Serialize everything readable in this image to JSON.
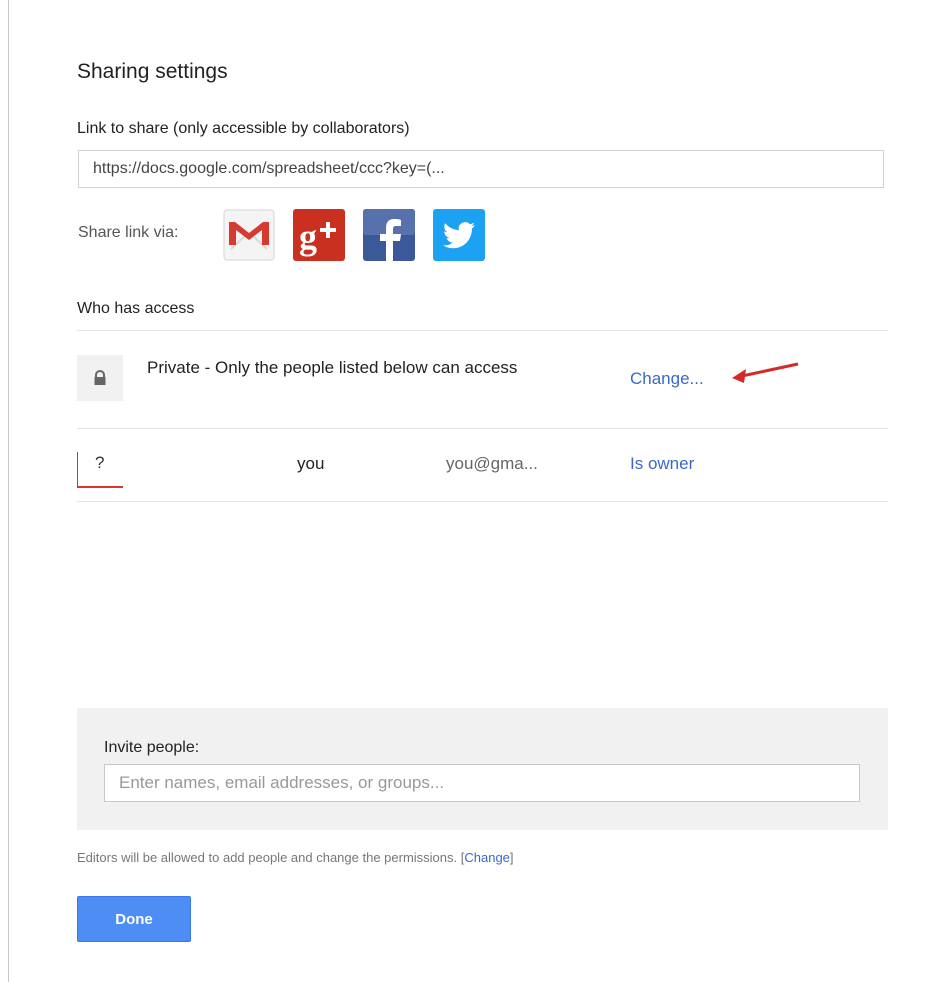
{
  "dialog": {
    "title": "Sharing settings"
  },
  "link": {
    "label": "Link to share (only accessible by collaborators)",
    "url": "https://docs.google.com/spreadsheet/ccc?key=(..."
  },
  "share_via": {
    "label": "Share link via:",
    "services": [
      {
        "name": "Gmail",
        "icon": "gmail-icon",
        "color": "#d14836"
      },
      {
        "name": "Google+",
        "icon": "google-plus-icon",
        "color": "#c7271a"
      },
      {
        "name": "Facebook",
        "icon": "facebook-icon",
        "color": "#3b5998"
      },
      {
        "name": "Twitter",
        "icon": "twitter-icon",
        "color": "#1da1f2"
      }
    ]
  },
  "access": {
    "heading": "Who has access",
    "visibility_text": "Private - Only the people listed below can access",
    "change_label": "Change..."
  },
  "people": [
    {
      "avatar_text": "?",
      "name": "you",
      "email": "you@gma...",
      "role": "Is owner"
    }
  ],
  "invite": {
    "label": "Invite people:",
    "placeholder": "Enter names, email addresses, or groups..."
  },
  "editors_note": {
    "text": "Editors will be allowed to add people and change the permissions.",
    "link_open": "[",
    "link_label": "Change",
    "link_close": "]"
  },
  "done_label": "Done",
  "colors": {
    "link_blue": "#3b68c7",
    "done_blue": "#4d8df4",
    "panel_gray": "#f1f1f1",
    "arrow_red": "#d32a2a"
  }
}
